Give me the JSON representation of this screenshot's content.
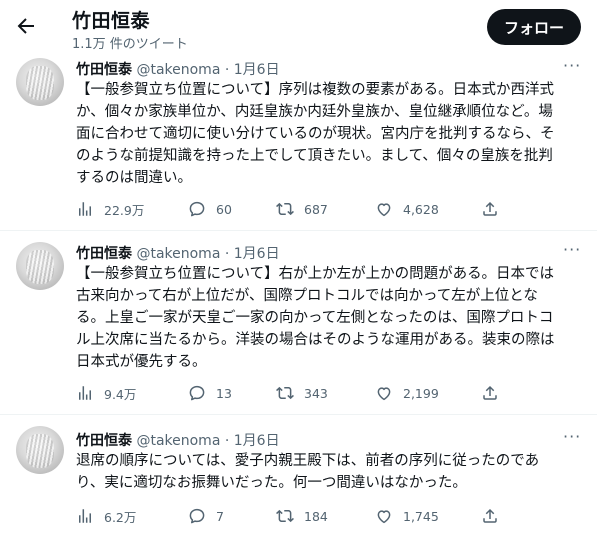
{
  "header": {
    "title": "竹田恒泰",
    "subtitle": "1.1万 件のツイート",
    "follow_label": "フォロー"
  },
  "tweets": [
    {
      "name": "竹田恒泰",
      "handle": "@takenoma",
      "dot": "·",
      "date": "1月6日",
      "text": "【一般参賀立ち位置について】序列は複数の要素がある。日本式か西洋式\nか、個々か家族単位か、内廷皇族か内廷外皇族か、皇位継承順位など。場\n面に合わせて適切に使い分けているのが現状。宮内庁を批判するなら、そ\nのような前提知識を持った上でして頂きたい。まして、個々の皇族を批判\nするのは間違い。",
      "views": "22.9万",
      "replies": "60",
      "retweets": "687",
      "likes": "4,628"
    },
    {
      "name": "竹田恒泰",
      "handle": "@takenoma",
      "dot": "·",
      "date": "1月6日",
      "text": "【一般参賀立ち位置について】右が上か左が上かの問題がある。日本では\n古来向かって右が上位だが、国際プロトコルでは向かって左が上位とな\nる。上皇ご一家が天皇ご一家の向かって左側となったのは、国際プロトコ\nル上次席に当たるから。洋装の場合はそのような運用がある。装束の際は\n日本式が優先する。",
      "views": "9.4万",
      "replies": "13",
      "retweets": "343",
      "likes": "2,199"
    },
    {
      "name": "竹田恒泰",
      "handle": "@takenoma",
      "dot": "·",
      "date": "1月6日",
      "text": "退席の順序については、愛子内親王殿下は、前者の序列に従ったのであ\nり、実に適切なお振舞いだった。何一つ間違いはなかった。",
      "views": "6.2万",
      "replies": "7",
      "retweets": "184",
      "likes": "1,745"
    }
  ],
  "icons": {
    "back": "arrow-left-icon",
    "more": "more-icon",
    "views": "bar-chart-icon",
    "reply": "reply-icon",
    "retweet": "retweet-icon",
    "like": "heart-icon",
    "share": "share-icon"
  },
  "colors": {
    "text": "#0f1419",
    "secondary": "#536471",
    "follow_bg": "#0f1419",
    "divider": "#eff3f4"
  }
}
